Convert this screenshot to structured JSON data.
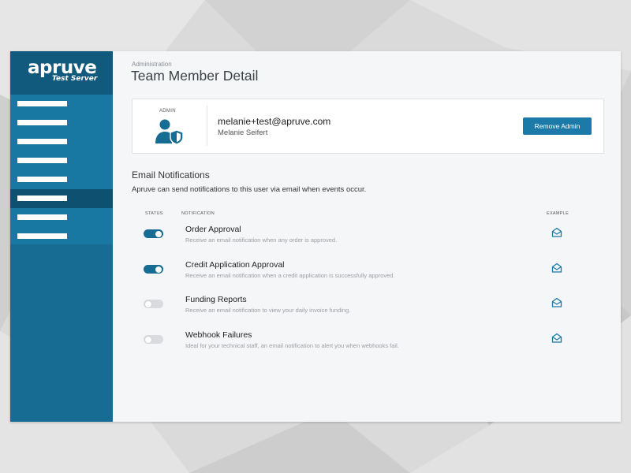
{
  "app": {
    "logo_text": "apruve",
    "logo_subtitle": "Test Server",
    "colors": {
      "sidebar": "#176c93",
      "sidebar_dark": "#125a7d",
      "accent": "#1b7aa8",
      "toggle_off": "#d9dbde"
    }
  },
  "sidebar": {
    "items": [
      {
        "active": false
      },
      {
        "active": false
      },
      {
        "active": false
      },
      {
        "active": false
      },
      {
        "active": false
      },
      {
        "active": true
      },
      {
        "active": false
      },
      {
        "active": false
      }
    ]
  },
  "header": {
    "breadcrumb": "Administration",
    "title": "Team Member Detail"
  },
  "member": {
    "role_label": "ADMIN",
    "role_icon": "user-shield-icon",
    "email": "melanie+test@apruve.com",
    "name": "Melanie Seifert",
    "remove_label": "Remove Admin"
  },
  "notifications": {
    "title": "Email Notifications",
    "description": "Apruve can send notifications to this user via email when events occur.",
    "columns": {
      "status": "STATUS",
      "notification": "NOTIFICATION",
      "example": "EXAMPLE"
    },
    "example_icon": "envelope-open-icon",
    "rows": [
      {
        "title": "Order Approval",
        "description": "Receive an email notification when any order is approved.",
        "enabled": true
      },
      {
        "title": "Credit Application Approval",
        "description": "Receive an email notification when a credit application is successfully approved.",
        "enabled": true
      },
      {
        "title": "Funding Reports",
        "description": "Receive an email notification to view your daily invoice funding.",
        "enabled": false
      },
      {
        "title": "Webhook Failures",
        "description": "Ideal for your technical staff, an email notification to alert you when  webhooks fail.",
        "enabled": false
      }
    ]
  }
}
